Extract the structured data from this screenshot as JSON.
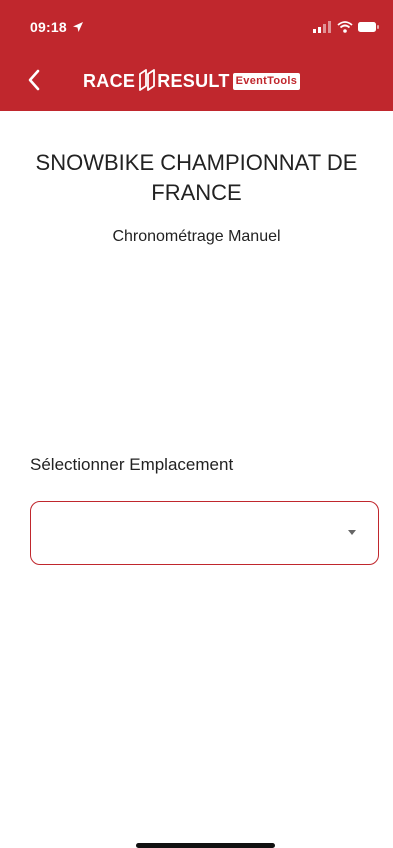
{
  "status_bar": {
    "time": "09:18"
  },
  "header": {
    "brand_race": "RACE",
    "brand_result": "RESULT",
    "brand_badge": "EventTools",
    "color": "#c0272d"
  },
  "event": {
    "title": "SNOWBIKE CHAMPIONNAT DE FRANCE",
    "subtitle": "Chronométrage Manuel"
  },
  "location_select": {
    "label": "Sélectionner Emplacement",
    "value": ""
  },
  "icons": [
    "location-arrow-icon",
    "signal-icon",
    "wifi-icon",
    "battery-icon",
    "back-chevron-icon",
    "race-result-logo-icon",
    "dropdown-caret-icon"
  ]
}
